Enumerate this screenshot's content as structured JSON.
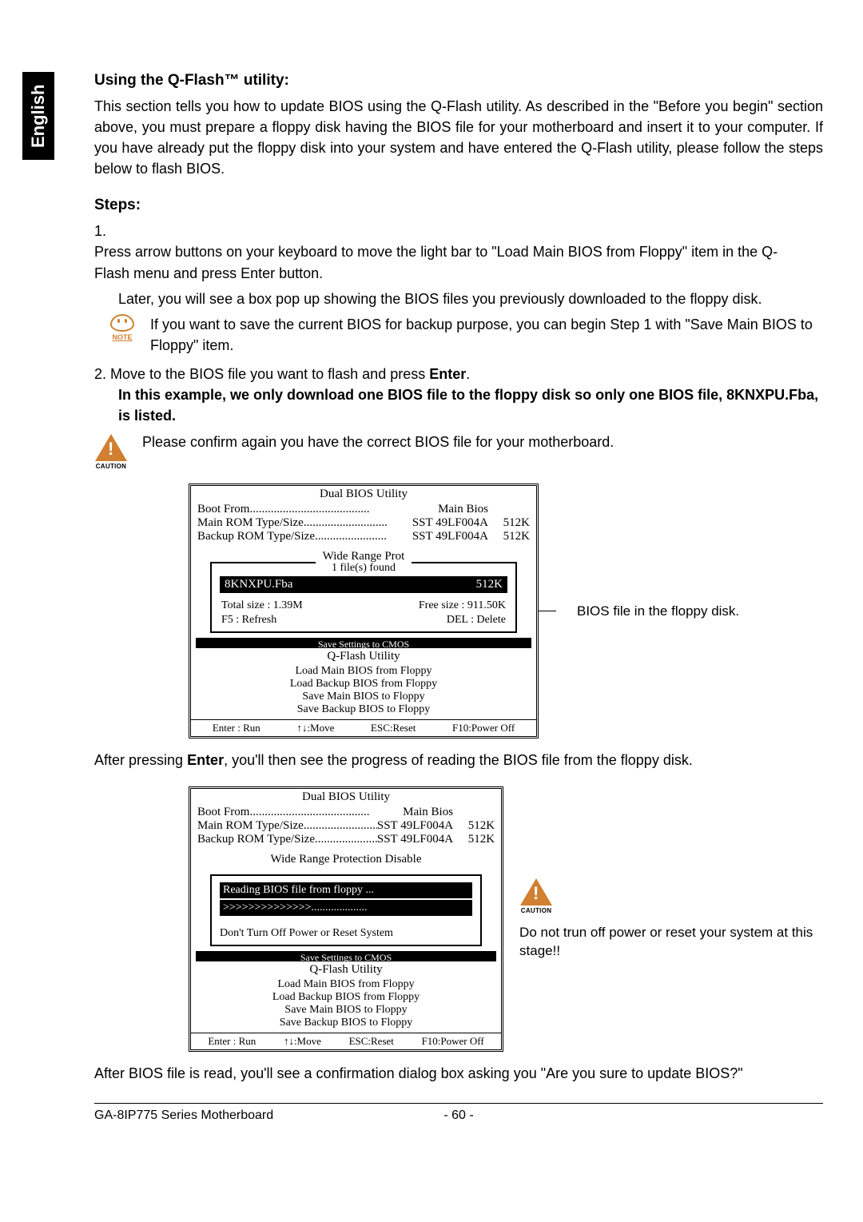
{
  "lang_tab": "English",
  "heading": "Using the Q-Flash™ utility:",
  "intro": "This section tells you how to update BIOS using the Q-Flash utility. As described in the \"Before you begin\" section above, you must prepare a floppy disk having the BIOS file for your motherboard and insert it to your computer. If you have already put the floppy disk into your system and have entered the Q-Flash utility, please follow the steps below to flash BIOS.",
  "steps_heading": "Steps:",
  "step1_num": "1.",
  "step1_text": "Press arrow buttons on your keyboard to move the light bar to \"Load Main BIOS from Floppy\" item in the Q-Flash menu and press Enter button.",
  "step1_later": "Later, you will see a box pop up showing the BIOS files you previously downloaded to the floppy disk.",
  "note_label": "NOTE",
  "note_text": "If you want to save the current BIOS for backup purpose, you can begin Step 1 with \"Save Main BIOS to Floppy\" item.",
  "step2_text": "2. Move to the BIOS file you want to flash and press ",
  "step2_enter": "Enter",
  "step2_dot": ".",
  "example_bold": "In this example, we only download one BIOS file to the floppy disk so only one BIOS file, 8KNXPU.Fba, is listed.",
  "caution_label": "CAUTION",
  "caution_text": "Please confirm again you have the correct BIOS file for your motherboard.",
  "bios": {
    "title": "Dual BIOS Utility",
    "boot_from_label": "Boot From",
    "boot_from_dots": "........................................",
    "boot_from_val": "Main Bios",
    "main_rom_label": "Main ROM Type/Size",
    "main_rom_dots": "............................",
    "main_rom_val": "SST 49LF004A",
    "main_rom_k": "512K",
    "backup_rom_label": "Backup ROM Type/Size",
    "backup_rom_dots": "........................",
    "backup_rom_val": "SST 49LF004A",
    "backup_rom_k": "512K",
    "wrp_partial": "Wide Range Prot",
    "wrp_full": "Wide Range Protection    Disable",
    "popup_title": "1 file(s) found",
    "popup_file_name": "8KNXPU.Fba",
    "popup_file_size": "512K",
    "total_size": "Total size : 1.39M",
    "free_size": "Free size : 911.50K",
    "f5": "F5 : Refresh",
    "del": "DEL : Delete",
    "save_cmos": "Save Settings to CMOS",
    "qflash_title": "Q-Flash Utility",
    "items": [
      "Load Main BIOS from Floppy",
      "Load Backup BIOS from Floppy",
      "Save Main BIOS to Floppy",
      "Save Backup BIOS to Floppy"
    ],
    "keys": {
      "enter": "Enter : Run",
      "move": "↑↓:Move",
      "esc": "ESC:Reset",
      "f10": "F10:Power Off"
    }
  },
  "side_note1": "BIOS file in the floppy disk.",
  "after1_pre": "After pressing ",
  "after1_enter": "Enter",
  "after1_post": ", you'll then see the progress of reading the BIOS file from the floppy disk.",
  "reading": {
    "line1": "Reading BIOS file from floppy ...",
    "line2": ">>>>>>>>>>>>>>....................",
    "warn": "Don't Turn Off Power or Reset System"
  },
  "side_note2": "Do not trun off power or reset your system at this stage!!",
  "after2": "After BIOS file is read, you'll see a confirmation dialog box asking you \"Are you sure to update BIOS?\"",
  "footer": {
    "left": "GA-8IP775 Series Motherboard",
    "page": "- 60 -"
  }
}
